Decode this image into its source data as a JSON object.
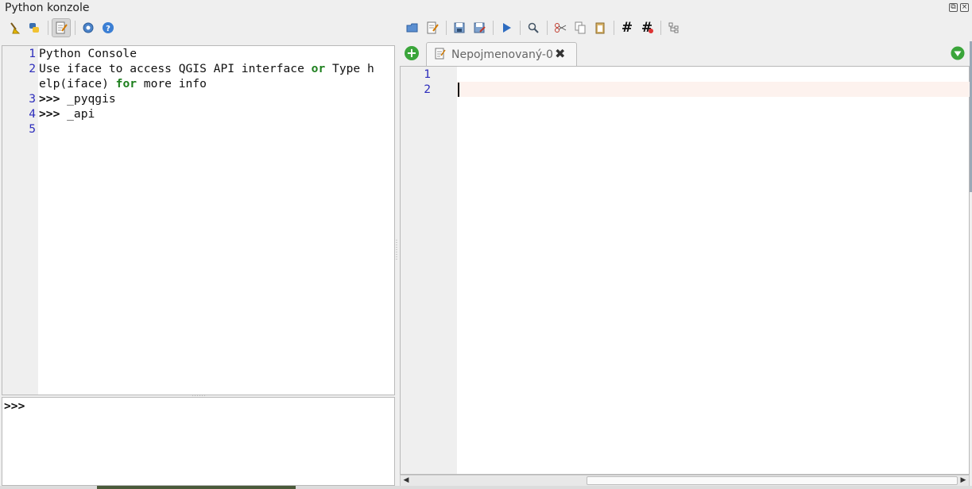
{
  "window": {
    "title": "Python konzole",
    "float_glyph": "⧉",
    "close_glyph": "×"
  },
  "console_toolbar": {
    "items": [
      "clear-console",
      "run-script",
      "show-editor",
      "settings",
      "help"
    ]
  },
  "editor_toolbar": {
    "items": [
      "open-script",
      "open-in-external-editor",
      "save",
      "save-as",
      "run-script",
      "find",
      "cut",
      "copy",
      "paste",
      "comment",
      "uncomment",
      "object-inspector"
    ],
    "comment_glyph": "#",
    "uncomment_glyph": "#"
  },
  "console": {
    "line_numbers": [
      "1",
      "2",
      "",
      "3",
      "4",
      "5"
    ],
    "line1": "Python Console",
    "line2a_pre": "Use iface to access QGIS API interface ",
    "line2a_kw": "or",
    "line2a_post": " Type h",
    "line2b_pre": "elp(iface) ",
    "line2b_kw": "for",
    "line2b_post": " more info",
    "line3_prompt": ">>>",
    "line3_text": " _pyqgis",
    "line4_prompt": ">>>",
    "line4_text": " _api",
    "input_prompt": ">>>"
  },
  "editor": {
    "add_tab_glyph": "+",
    "tab_label": "Nepojmenovaný-0",
    "tab_close_glyph": "✖",
    "line_numbers": [
      "1",
      "2"
    ],
    "scroll_left": "◀",
    "scroll_right": "▶"
  },
  "colors": {
    "keyword": "#1d7f1d",
    "line_number": "#2d2dbc",
    "current_line": "#fdf2ee",
    "accent_green": "#3aa53a"
  }
}
